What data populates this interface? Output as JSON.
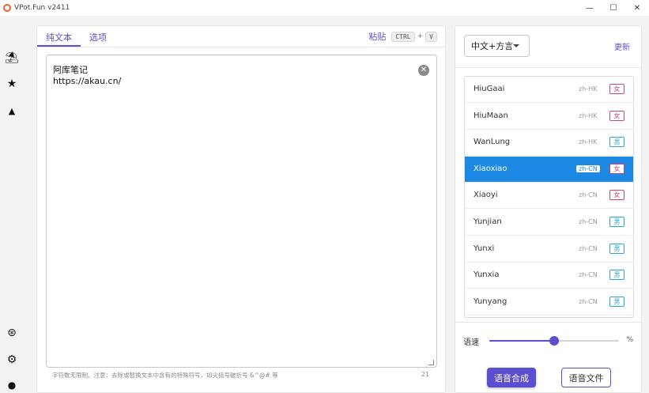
{
  "window": {
    "title": "VPot.Fun v2411",
    "controls": [
      "—",
      "☐",
      "✕"
    ]
  },
  "sidebar": {
    "icons": [
      {
        "name": "broadcast-icon",
        "glyph": "⛱"
      },
      {
        "name": "star-icon",
        "glyph": "★"
      },
      {
        "name": "azure-icon",
        "glyph": "▲"
      },
      {
        "name": "aperture-icon",
        "glyph": "⊛"
      },
      {
        "name": "gear-icon",
        "glyph": "⚙"
      },
      {
        "name": "android-icon",
        "glyph": "●"
      }
    ]
  },
  "editor_panel": {
    "tabs": [
      {
        "label": "纯文本",
        "active": true
      },
      {
        "label": "选项",
        "active": false
      }
    ],
    "paste_label": "粘贴",
    "shortcut_ctrl": "CTRL",
    "shortcut_plus": "+",
    "shortcut_v": "V",
    "text_line1": "阿库笔记",
    "text_line2": "https://akau.cn/",
    "hint": "字符数无限制。注意：去除或替换文本中含有的特殊符号，如尖括号破折号 &^@# 等",
    "char_count": "21"
  },
  "voice_panel": {
    "language": "中文+方言",
    "refresh_label": "更新",
    "voices": [
      {
        "name": "HiuGaai",
        "locale": "zh-HK",
        "gender": "女",
        "g": "female",
        "selected": false
      },
      {
        "name": "HiuMaan",
        "locale": "zh-HK",
        "gender": "女",
        "g": "female",
        "selected": false
      },
      {
        "name": "WanLung",
        "locale": "zh-HK",
        "gender": "男",
        "g": "male",
        "selected": false
      },
      {
        "name": "Xiaoxiao",
        "locale": "zh-CN",
        "gender": "女",
        "g": "female",
        "selected": true
      },
      {
        "name": "Xiaoyi",
        "locale": "zh-CN",
        "gender": "女",
        "g": "female",
        "selected": false
      },
      {
        "name": "Yunjian",
        "locale": "zh-CN",
        "gender": "男",
        "g": "male",
        "selected": false
      },
      {
        "name": "Yunxi",
        "locale": "zh-CN",
        "gender": "男",
        "g": "male",
        "selected": false
      },
      {
        "name": "Yunxia",
        "locale": "zh-CN",
        "gender": "男",
        "g": "male",
        "selected": false
      },
      {
        "name": "Yunyang",
        "locale": "zh-CN",
        "gender": "男",
        "g": "male",
        "selected": false
      }
    ],
    "speed_label": "语速",
    "speed_unit": "%",
    "speed_fraction": 0.5,
    "synth_button": "语音合成",
    "file_button": "语音文件"
  },
  "colors": {
    "accent": "#5b4fcf",
    "selected_row": "#1e88e5",
    "female": "#d0466e",
    "male": "#2aa8c9"
  }
}
